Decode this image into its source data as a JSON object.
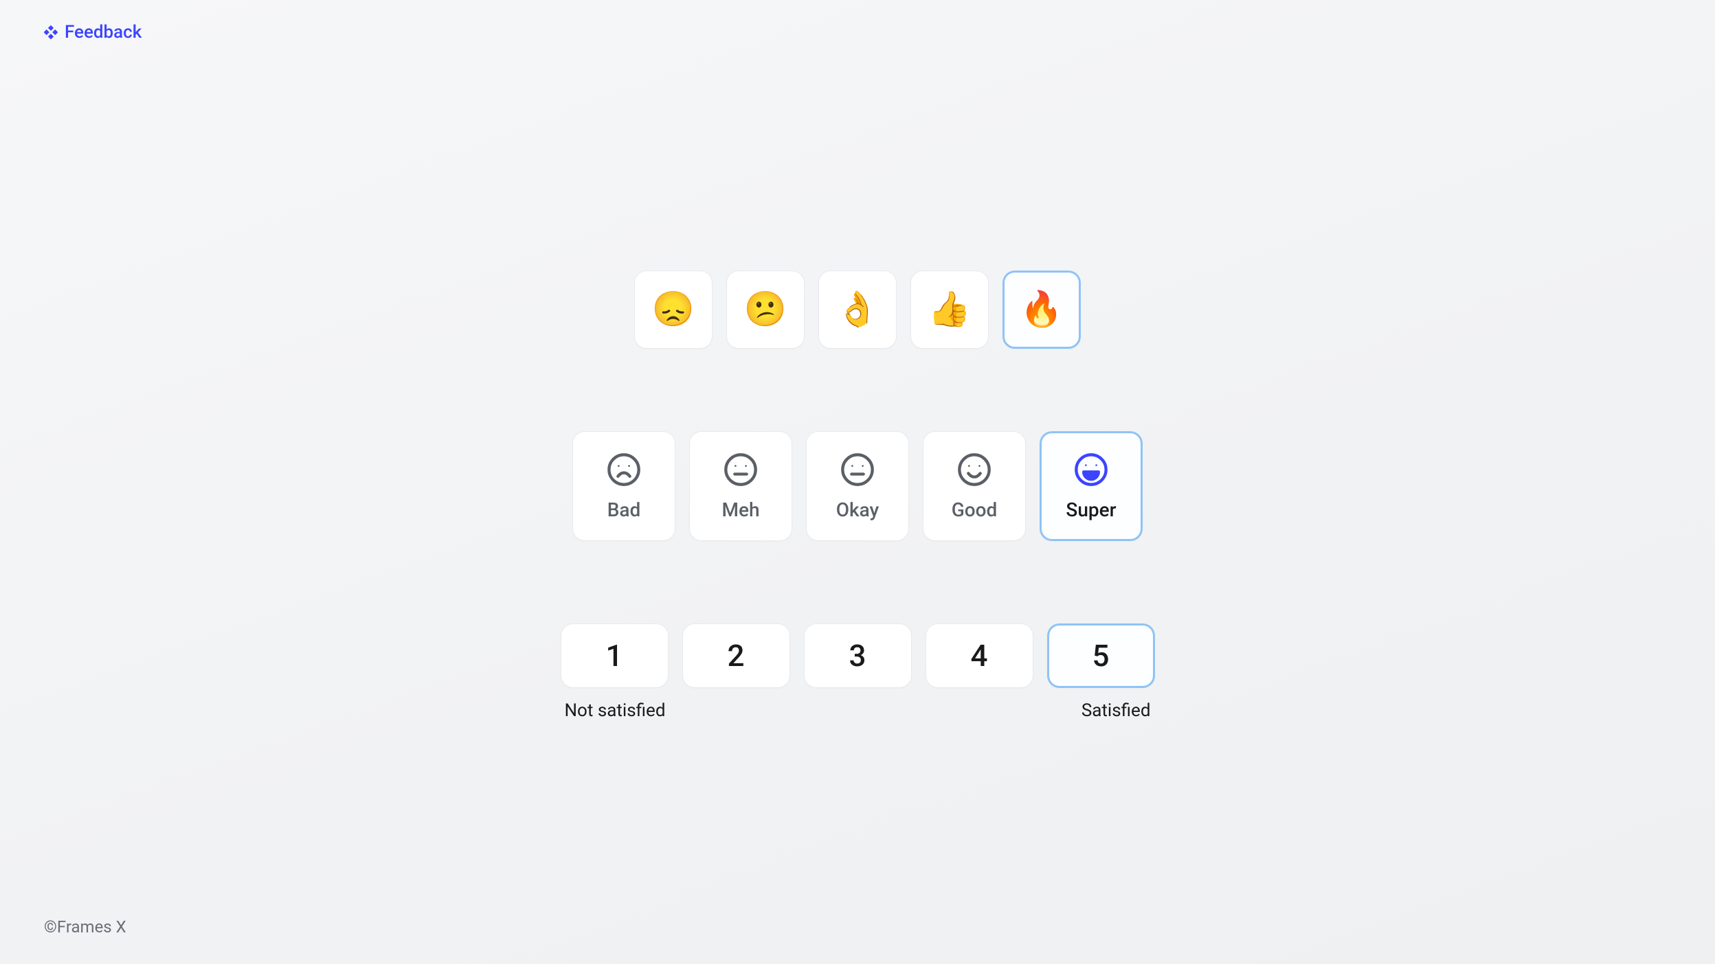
{
  "header": {
    "title": "Feedback"
  },
  "footer": {
    "copyright": "©Frames X"
  },
  "rowEmoji": {
    "items": [
      {
        "emoji": "😞",
        "selected": false
      },
      {
        "emoji": "😕",
        "selected": false
      },
      {
        "emoji": "👌",
        "selected": false
      },
      {
        "emoji": "👍",
        "selected": false
      },
      {
        "emoji": "🔥",
        "selected": true
      }
    ]
  },
  "rowFace": {
    "items": [
      {
        "label": "Bad",
        "face": "sad",
        "selected": false
      },
      {
        "label": "Meh",
        "face": "neutral",
        "selected": false
      },
      {
        "label": "Okay",
        "face": "neutral",
        "selected": false
      },
      {
        "label": "Good",
        "face": "smile",
        "selected": false
      },
      {
        "label": "Super",
        "face": "grin",
        "selected": true
      }
    ]
  },
  "rowNum": {
    "items": [
      {
        "value": "1",
        "selected": false
      },
      {
        "value": "2",
        "selected": false
      },
      {
        "value": "3",
        "selected": false
      },
      {
        "value": "4",
        "selected": false
      },
      {
        "value": "5",
        "selected": true
      }
    ],
    "lowLabel": "Not satisfied",
    "highLabel": "Satisfied"
  }
}
